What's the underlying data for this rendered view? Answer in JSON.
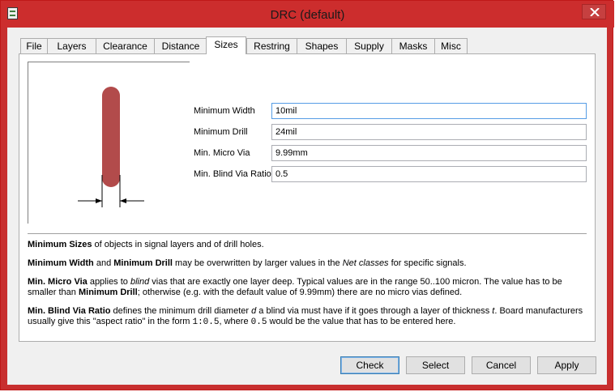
{
  "window": {
    "title": "DRC (default)"
  },
  "tabs": [
    {
      "label": "File"
    },
    {
      "label": "Layers"
    },
    {
      "label": "Clearance"
    },
    {
      "label": "Distance"
    },
    {
      "label": "Sizes"
    },
    {
      "label": "Restring"
    },
    {
      "label": "Shapes"
    },
    {
      "label": "Supply"
    },
    {
      "label": "Masks"
    },
    {
      "label": "Misc"
    }
  ],
  "active_tab": "Sizes",
  "fields": {
    "min_width": {
      "label": "Minimum Width",
      "value": "10mil"
    },
    "min_drill": {
      "label": "Minimum Drill",
      "value": "24mil"
    },
    "min_micro_via": {
      "label": "Min. Micro Via",
      "value": "9.99mm"
    },
    "min_blind_ratio": {
      "label": "Min. Blind Via Ratio",
      "value": "0.5"
    }
  },
  "help": {
    "p1": {
      "b1": "Minimum Sizes",
      "t1": " of objects in signal layers and of drill holes."
    },
    "p2": {
      "b1": "Minimum Width",
      "t1": " and ",
      "b2": "Minimum Drill",
      "t2": " may be overwritten by larger values in the ",
      "i1": "Net classes",
      "t3": " for specific signals."
    },
    "p3": {
      "b1": "Min. Micro Via",
      "t1": " applies to ",
      "i1": "blind",
      "t2": " vias that are exactly one layer deep. Typical values are in the range 50..100 micron. The value has to be smaller than ",
      "b2": "Minimum Drill",
      "t3": "; otherwise (e.g. with the default value of 9.99mm) there are no micro vias defined."
    },
    "p4": {
      "b1": "Min. Blind Via Ratio",
      "t1": " defines the minimum drill diameter ",
      "i1": "d",
      "t2": " a blind via must have if it goes through a layer of thickness ",
      "i2": "t",
      "t3": ". Board manufacturers usually give this \"aspect ratio\" in the form ",
      "m1": "1:0.5",
      "t4": ", where ",
      "m2": "0.5",
      "t5": " would be the value that has to be entered here."
    }
  },
  "buttons": {
    "check": "Check",
    "select": "Select",
    "cancel": "Cancel",
    "apply": "Apply"
  },
  "colors": {
    "titlebar": "#cc2d2d",
    "trace": "#b24b4b",
    "dialog_bg": "#f0f0f0",
    "focus_border": "#569de5"
  }
}
